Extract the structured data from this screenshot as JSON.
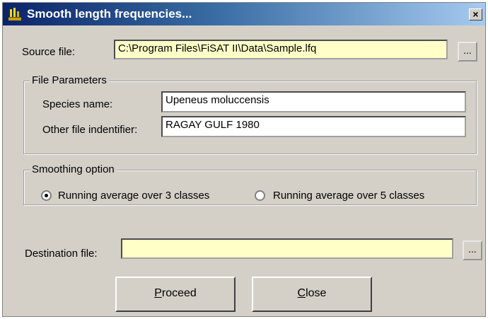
{
  "window": {
    "title": "Smooth length frequencies..."
  },
  "close_glyph": "×",
  "source": {
    "label": "Source file:",
    "value": "C:\\Program Files\\FiSAT II\\Data\\Sample.lfq",
    "browse_label": "..."
  },
  "file_parameters": {
    "group_title": "File Parameters",
    "species_label": "Species name:",
    "species_value": "Upeneus moluccensis",
    "identifier_label": "Other file indentifier:",
    "identifier_value": "RAGAY GULF 1980"
  },
  "smoothing": {
    "group_title": "Smoothing option",
    "options": [
      {
        "label": "Running average over 3 classes",
        "selected": true
      },
      {
        "label": "Running average over 5 classes",
        "selected": false
      }
    ]
  },
  "destination": {
    "label": "Destination file:",
    "value": "",
    "browse_label": "..."
  },
  "buttons": {
    "proceed_hotkey": "P",
    "proceed_rest": "roceed",
    "close_hotkey": "C",
    "close_rest": "lose"
  },
  "colors": {
    "title_start": "#0a246a",
    "title_end": "#a6caf0",
    "field_yellow": "#ffffc8",
    "face": "#d4d0c8"
  }
}
